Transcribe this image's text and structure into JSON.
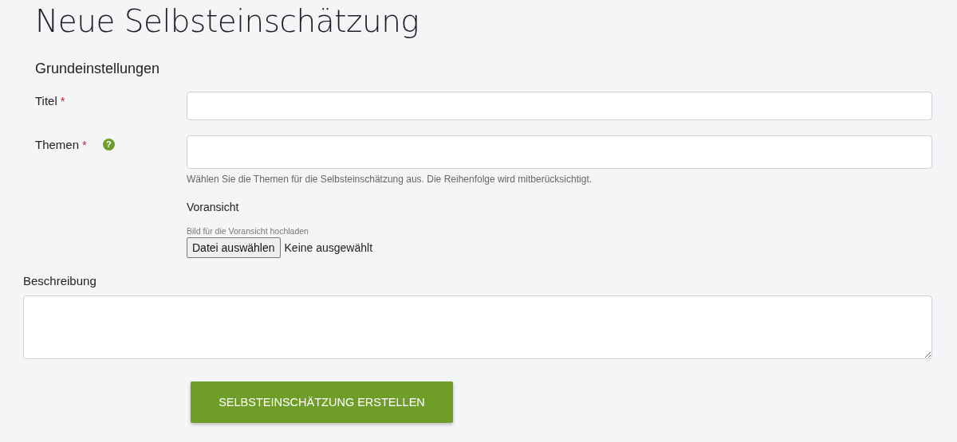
{
  "page_title": "Neue Selbsteinschätzung",
  "section_title": "Grundeinstellungen",
  "fields": [
    {
      "kind": "text",
      "label": "Titel",
      "required_mark": "*"
    },
    {
      "kind": "tags",
      "label": "Themen",
      "required_mark": "*",
      "help_icon": "?",
      "hint": "Wählen Sie die Themen für die Selbsteinschätzung aus. Die Reihenfolge wird mitberücksichtigt."
    }
  ],
  "preview": {
    "label": "Voransicht",
    "hint": "Bild für die Voransicht hochladen",
    "button": "Datei auswählen",
    "file_status": "Keine ausgewählt"
  },
  "description": {
    "label": "Beschreibung"
  },
  "submit_button": "SELBSTEINSCHÄTZUNG ERSTELLEN"
}
